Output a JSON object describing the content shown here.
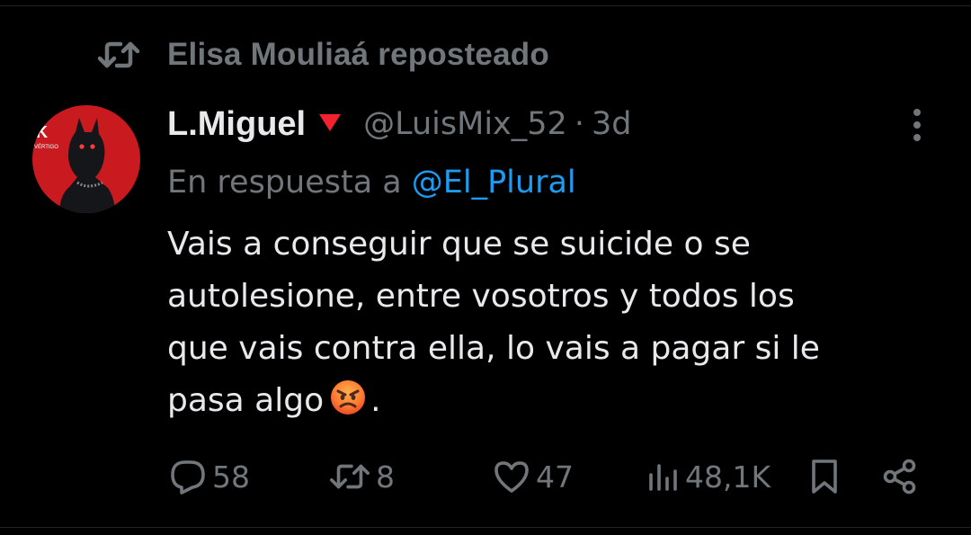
{
  "repost": {
    "icon": "repost-icon",
    "label": "Elisa Mouliaá reposteado"
  },
  "tweet": {
    "author": {
      "display_name": "L.Miguel",
      "flag_icon": "red-down-triangle-icon",
      "handle": "@LuisMix_52",
      "separator": "·",
      "age": "3d",
      "avatar": {
        "icon": "doberman-avatar",
        "text": "K",
        "subtext": "VÉRTIGO"
      }
    },
    "reply_to": {
      "prefix": "En respuesta a",
      "handle": "@El_Plural"
    },
    "text": {
      "line1": "Vais a conseguir que se suicide o se",
      "line2": "autolesione, entre vosotros y todos los",
      "line3": "que vais contra ella, lo vais a pagar si le",
      "line4_start": "pasa algo",
      "line4_emoji": "angry-face-emoji",
      "line4_end": "."
    }
  },
  "actions": {
    "reply": {
      "icon": "reply-bubble-icon",
      "count": "58"
    },
    "repost": {
      "icon": "repost-icon",
      "count": "8"
    },
    "like": {
      "icon": "heart-icon",
      "count": "47"
    },
    "views": {
      "icon": "views-chart-icon",
      "count": "48,1K"
    },
    "bookmark": {
      "icon": "bookmark-icon"
    },
    "share": {
      "icon": "share-icon"
    }
  },
  "colors": {
    "background": "#000000",
    "text_primary": "#e7e9ea",
    "text_secondary": "#71767b",
    "link": "#1d9bf0",
    "flag": "#f4212e",
    "avatar_bg": "#c91a1f"
  }
}
